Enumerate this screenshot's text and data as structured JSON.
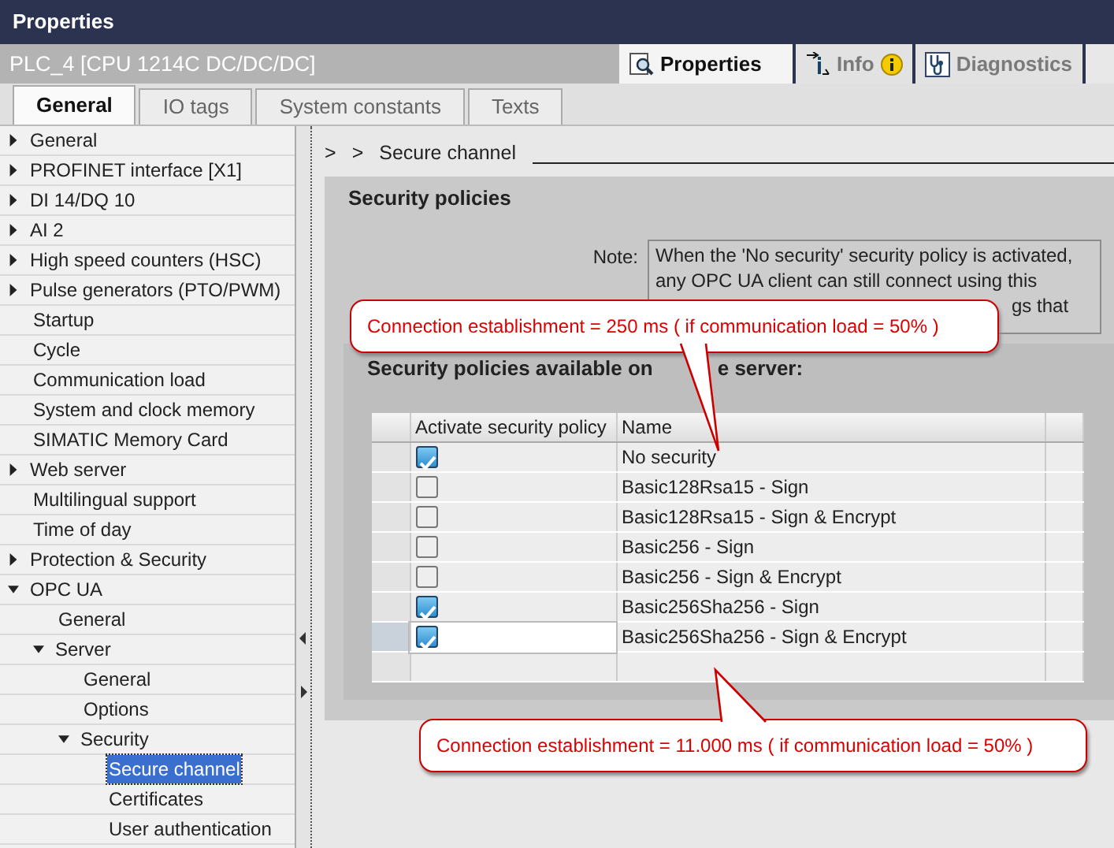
{
  "window": {
    "title": "Properties"
  },
  "header": {
    "object": "PLC_4 [CPU 1214C DC/DC/DC]"
  },
  "view_tabs": [
    {
      "label": "Properties",
      "kind": "properties",
      "selected": true,
      "notification": false
    },
    {
      "label": "Info",
      "kind": "info",
      "selected": false,
      "notification": true
    },
    {
      "label": "Diagnostics",
      "kind": "diagnostics",
      "selected": false,
      "notification": false
    }
  ],
  "sub_tabs": [
    {
      "label": "General",
      "selected": true
    },
    {
      "label": "IO tags",
      "selected": false
    },
    {
      "label": "System constants",
      "selected": false
    },
    {
      "label": "Texts",
      "selected": false
    }
  ],
  "tree": [
    {
      "label": "General",
      "expanded": false,
      "selected": false
    },
    {
      "label": "PROFINET interface [X1]",
      "expanded": false,
      "selected": false
    },
    {
      "label": "DI 14/DQ 10",
      "expanded": false,
      "selected": false
    },
    {
      "label": "AI 2",
      "expanded": false,
      "selected": false
    },
    {
      "label": "High speed counters (HSC)",
      "expanded": false,
      "selected": false
    },
    {
      "label": "Pulse generators (PTO/PWM)",
      "expanded": false,
      "selected": false
    },
    {
      "label": "Startup",
      "selected": false
    },
    {
      "label": "Cycle",
      "selected": false
    },
    {
      "label": "Communication load",
      "selected": false
    },
    {
      "label": "System and clock memory",
      "selected": false
    },
    {
      "label": "SIMATIC Memory Card",
      "selected": false
    },
    {
      "label": "Web server",
      "expanded": false,
      "selected": false
    },
    {
      "label": "Multilingual support",
      "selected": false
    },
    {
      "label": "Time of day",
      "selected": false
    },
    {
      "label": "Protection & Security",
      "expanded": false,
      "selected": false
    },
    {
      "label": "OPC UA",
      "expanded": true,
      "selected": false,
      "children": [
        {
          "label": "General",
          "selected": false
        },
        {
          "label": "Server",
          "expanded": true,
          "selected": false,
          "children": [
            {
              "label": "General",
              "selected": false
            },
            {
              "label": "Options",
              "selected": false
            },
            {
              "label": "Security",
              "expanded": true,
              "selected": false,
              "children": [
                {
                  "label": "Secure channel",
                  "selected": true
                },
                {
                  "label": "Certificates",
                  "selected": false
                },
                {
                  "label": "User authentication",
                  "selected": false
                }
              ]
            }
          ]
        }
      ]
    }
  ],
  "breadcrumb": {
    "separators": [
      ">",
      ">"
    ],
    "current": "Secure channel"
  },
  "section": {
    "title": "Security policies",
    "note_label": "Note:",
    "note_lines": [
      {
        "text": "When the 'No security' security policy is activated,",
        "kind": "full"
      },
      {
        "text": "any OPC UA client can still connect using this",
        "kind": "full"
      },
      {
        "text": "gs that",
        "kind": "tail"
      }
    ]
  },
  "policies": {
    "heading_parts": [
      "Security policies available on",
      "e server:"
    ],
    "columns": [
      "Activate security policy",
      "Name"
    ],
    "rows": [
      {
        "active": true,
        "name": "No security",
        "selected": false
      },
      {
        "active": false,
        "name": "Basic128Rsa15 - Sign",
        "selected": false
      },
      {
        "active": false,
        "name": "Basic128Rsa15 - Sign & Encrypt",
        "selected": false
      },
      {
        "active": false,
        "name": "Basic256 - Sign",
        "selected": false
      },
      {
        "active": false,
        "name": "Basic256 - Sign & Encrypt",
        "selected": false
      },
      {
        "active": true,
        "name": "Basic256Sha256 - Sign",
        "selected": false
      },
      {
        "active": true,
        "name": "Basic256Sha256 - Sign & Encrypt",
        "selected": true
      }
    ]
  },
  "callouts": [
    {
      "text": "Connection establishment = 250 ms ( if communication load = 50% )"
    },
    {
      "text": "Connection establishment = 11.000 ms ( if communication load = 50% )"
    }
  ]
}
